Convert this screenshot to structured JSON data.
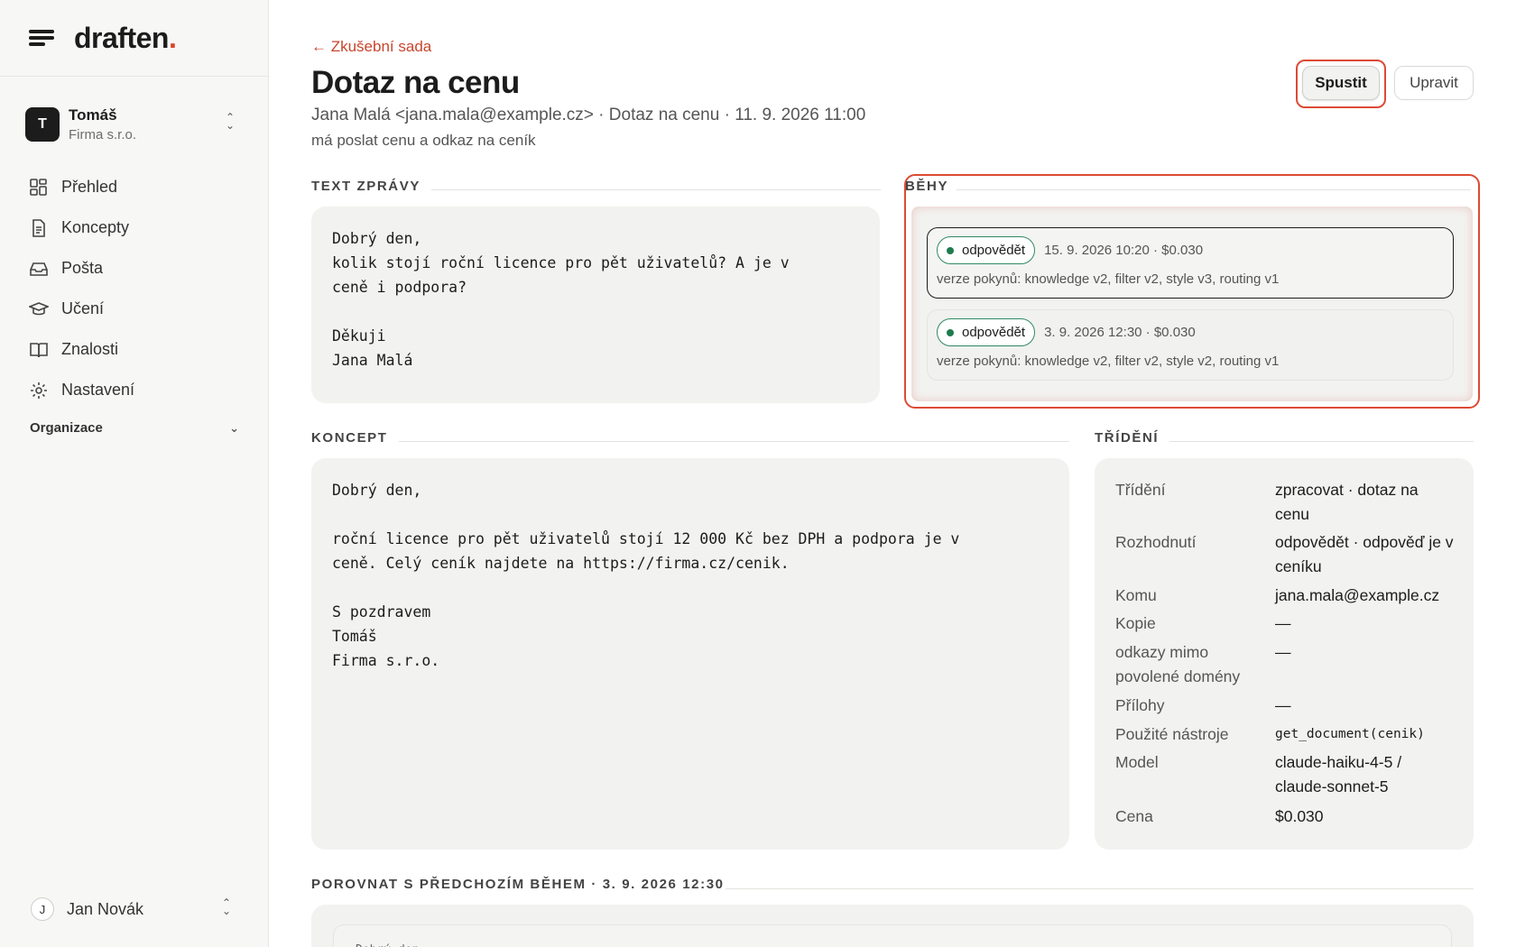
{
  "brand": {
    "logo": "draften",
    "logo_dot": "."
  },
  "org": {
    "initial": "T",
    "name": "Tomáš",
    "company": "Firma s.r.o."
  },
  "nav": [
    {
      "label": "Přehled",
      "icon": "grid-icon"
    },
    {
      "label": "Koncepty",
      "icon": "document-icon"
    },
    {
      "label": "Pošta",
      "icon": "inbox-icon"
    },
    {
      "label": "Učení",
      "icon": "graduation-cap-icon"
    },
    {
      "label": "Znalosti",
      "icon": "book-icon"
    },
    {
      "label": "Nastavení",
      "icon": "gear-icon"
    }
  ],
  "org_group": {
    "label": "Organizace"
  },
  "user": {
    "initial": "J",
    "name": "Jan Novák"
  },
  "header": {
    "back_link": "← Zkušební sada",
    "title": "Dotaz na cenu",
    "meta": "Jana Malá <jana.mala@example.cz> · Dotaz na cenu · 11. 9. 2026 11:00",
    "subtitle": "má poslat cenu a odkaz na ceník",
    "run_button": "Spustit",
    "edit_button": "Upravit"
  },
  "message": {
    "label": "TEXT ZPRÁVY",
    "body": "Dobrý den,\nkolik stojí roční licence pro pět uživatelů? A je v\nceně i podpora?\n\nDěkuji\nJana Malá"
  },
  "runs": {
    "label": "BĚHY",
    "items": [
      {
        "status": "odpovědět",
        "when": "15. 9. 2026 10:20 · $0.030",
        "versions": "verze pokynů: knowledge v2, filter v2, style v3, routing v1"
      },
      {
        "status": "odpovědět",
        "when": "3. 9. 2026 12:30 · $0.030",
        "versions": "verze pokynů: knowledge v2, filter v2, style v2, routing v1"
      }
    ]
  },
  "draft": {
    "label": "KONCEPT",
    "body": "Dobrý den,\n\nroční licence pro pět uživatelů stojí 12 000 Kč bez DPH a podpora je v\nceně. Celý ceník najdete na https://firma.cz/cenik.\n\nS pozdravem\nTomáš\nFirma s.r.o."
  },
  "triage": {
    "label": "TŘÍDĚNÍ",
    "rows": [
      {
        "key": "Třídění",
        "value": "zpracovat · dotaz na cenu"
      },
      {
        "key": "Rozhodnutí",
        "value": "odpovědět · odpověď je v ceníku"
      },
      {
        "key": "Komu",
        "value": "jana.mala@example.cz"
      },
      {
        "key": "Kopie",
        "value": "—"
      },
      {
        "key": "odkazy mimo povolené domény",
        "value": "—"
      },
      {
        "key": "Přílohy",
        "value": "—"
      },
      {
        "key": "Použité nástroje",
        "value": "get_document(cenik)"
      },
      {
        "key": "Model",
        "value": "claude-haiku-4-5 / claude-sonnet-5"
      },
      {
        "key": "Cena",
        "value": "$0.030"
      }
    ]
  },
  "compare": {
    "label": "POROVNAT S PŘEDCHOZÍM BĚHEM · 3. 9. 2026 12:30",
    "preview": "Dobrý den,"
  },
  "colors": {
    "accent": "#dd4a34",
    "success": "#1f7a4f",
    "card": "#f2f2f0"
  }
}
